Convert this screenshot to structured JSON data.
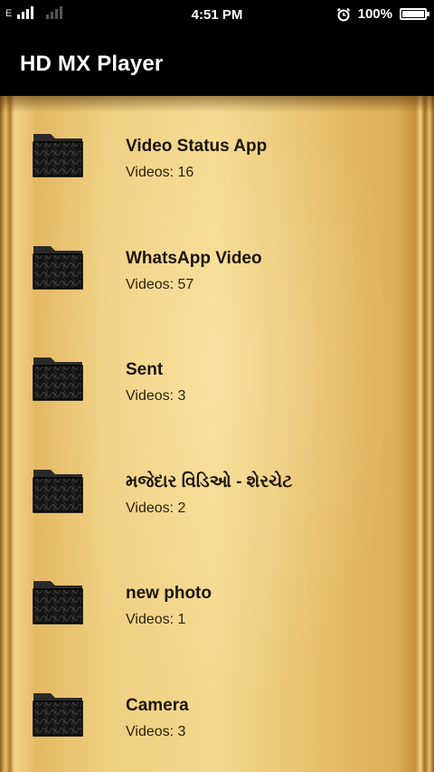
{
  "status_bar": {
    "network_label": "E",
    "time": "4:51 PM",
    "battery_percent": "100%",
    "icons": [
      "signal-icon",
      "signal-dim-icon",
      "alarm-icon",
      "battery-icon"
    ]
  },
  "app_bar": {
    "title": "HD MX Player"
  },
  "folders": [
    {
      "title": "Video Status App",
      "count": "Videos: 16"
    },
    {
      "title": "WhatsApp Video",
      "count": "Videos: 57"
    },
    {
      "title": "Sent",
      "count": "Videos: 3"
    },
    {
      "title": "મજેદાર વિડિઓ - શેરચેટ",
      "count": "Videos: 2"
    },
    {
      "title": "new photo",
      "count": "Videos: 1"
    },
    {
      "title": "Camera",
      "count": "Videos: 3"
    }
  ],
  "colors": {
    "status_bar_bg": "#000000",
    "app_bar_bg": "#000000",
    "gold": "#efcf80",
    "text_dark": "#1c140a"
  }
}
